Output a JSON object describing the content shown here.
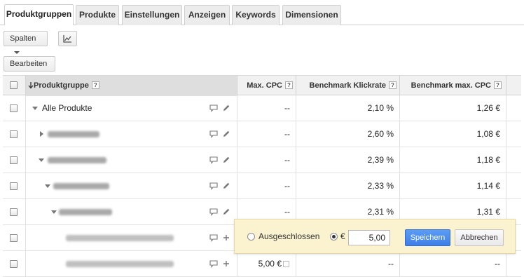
{
  "tabs": [
    {
      "label": "Produktgruppen",
      "active": true
    },
    {
      "label": "Produkte"
    },
    {
      "label": "Einstellungen"
    },
    {
      "label": "Anzeigen"
    },
    {
      "label": "Keywords"
    },
    {
      "label": "Dimensionen"
    }
  ],
  "toolbar": {
    "columns_label": "Spalten",
    "chart_icon": "line-chart-icon",
    "edit_label": "Bearbeiten"
  },
  "table": {
    "headers": {
      "product_group": "Produktgruppe",
      "max_cpc": "Max. CPC",
      "benchmark_ctr": "Benchmark Klickrate",
      "benchmark_max_cpc": "Benchmark max. CPC",
      "help": "?"
    },
    "rows": [
      {
        "name": "Alle Produkte",
        "max_cpc": "--",
        "benchmark_ctr": "2,10 %",
        "benchmark_max_cpc": "1,26 €"
      },
      {
        "name": "",
        "max_cpc": "--",
        "benchmark_ctr": "2,60 %",
        "benchmark_max_cpc": "1,08 €"
      },
      {
        "name": "",
        "max_cpc": "--",
        "benchmark_ctr": "2,39 %",
        "benchmark_max_cpc": "1,18 €"
      },
      {
        "name": "",
        "max_cpc": "--",
        "benchmark_ctr": "2,33 %",
        "benchmark_max_cpc": "1,14 €"
      },
      {
        "name": "",
        "max_cpc": "--",
        "benchmark_ctr": "2,31 %",
        "benchmark_max_cpc": "1,31 €"
      },
      {
        "name": "",
        "max_cpc": "",
        "benchmark_ctr": "",
        "benchmark_max_cpc": ""
      },
      {
        "name": "",
        "max_cpc": "5,00 €",
        "benchmark_ctr": "--",
        "benchmark_max_cpc": "--"
      }
    ]
  },
  "editor": {
    "excluded_label": "Ausgeschlossen",
    "currency": "€",
    "bid_value": "5,00",
    "save_label": "Speichern",
    "cancel_label": "Abbrechen"
  },
  "colors": {
    "primary_button": "#4a8af0",
    "popup_background": "#fbf3cf",
    "sorted_column": "#dedede"
  }
}
